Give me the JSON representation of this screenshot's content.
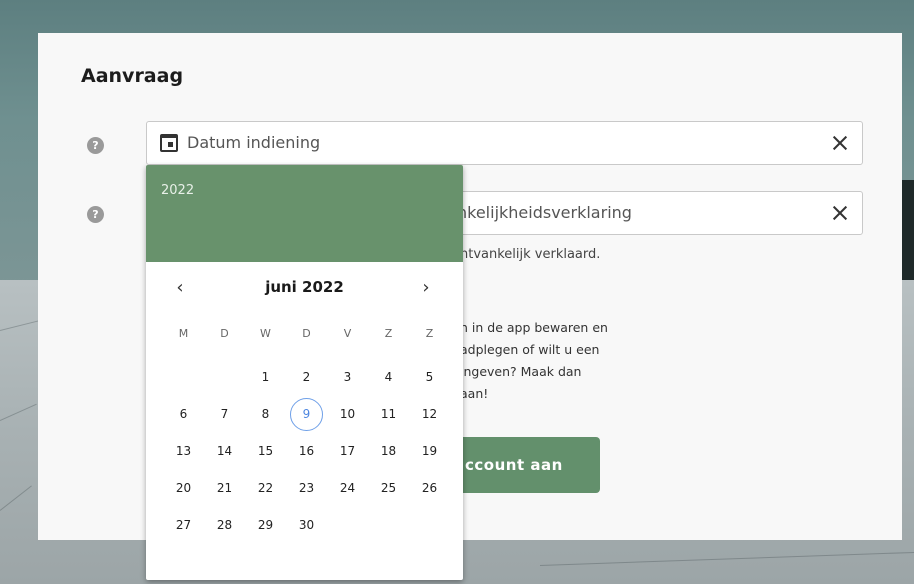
{
  "form": {
    "title": "Aanvraag",
    "date_field": {
      "value": "Datum indiening"
    },
    "second_field": {
      "value": "nkelijkheidsverklaring"
    },
    "second_hint": "ntvankelijk verklaard.",
    "info_lines": [
      "n in de app bewaren en",
      "adplegen of wilt u een",
      "ingeven? Maak dan",
      "aan!"
    ],
    "create_button_label": "ccount aan",
    "help_icon_glyph": "?"
  },
  "datepicker": {
    "year": "2022",
    "month_label": "juni 2022",
    "prev_glyph": "‹",
    "next_glyph": "›",
    "weekdays": [
      "M",
      "D",
      "W",
      "D",
      "V",
      "Z",
      "Z"
    ],
    "weeks": [
      [
        "",
        "",
        "1",
        "2",
        "3",
        "4",
        "5"
      ],
      [
        "6",
        "7",
        "8",
        "9",
        "10",
        "11",
        "12"
      ],
      [
        "13",
        "14",
        "15",
        "16",
        "17",
        "18",
        "19"
      ],
      [
        "20",
        "21",
        "22",
        "23",
        "24",
        "25",
        "26"
      ],
      [
        "27",
        "28",
        "29",
        "30",
        "",
        "",
        ""
      ]
    ],
    "today": "9",
    "accent_color": "#68926c",
    "today_ring_color": "#6fa0e8"
  },
  "icons": {
    "help": "question-circle-icon",
    "calendar": "calendar-icon",
    "clear": "close-icon"
  }
}
